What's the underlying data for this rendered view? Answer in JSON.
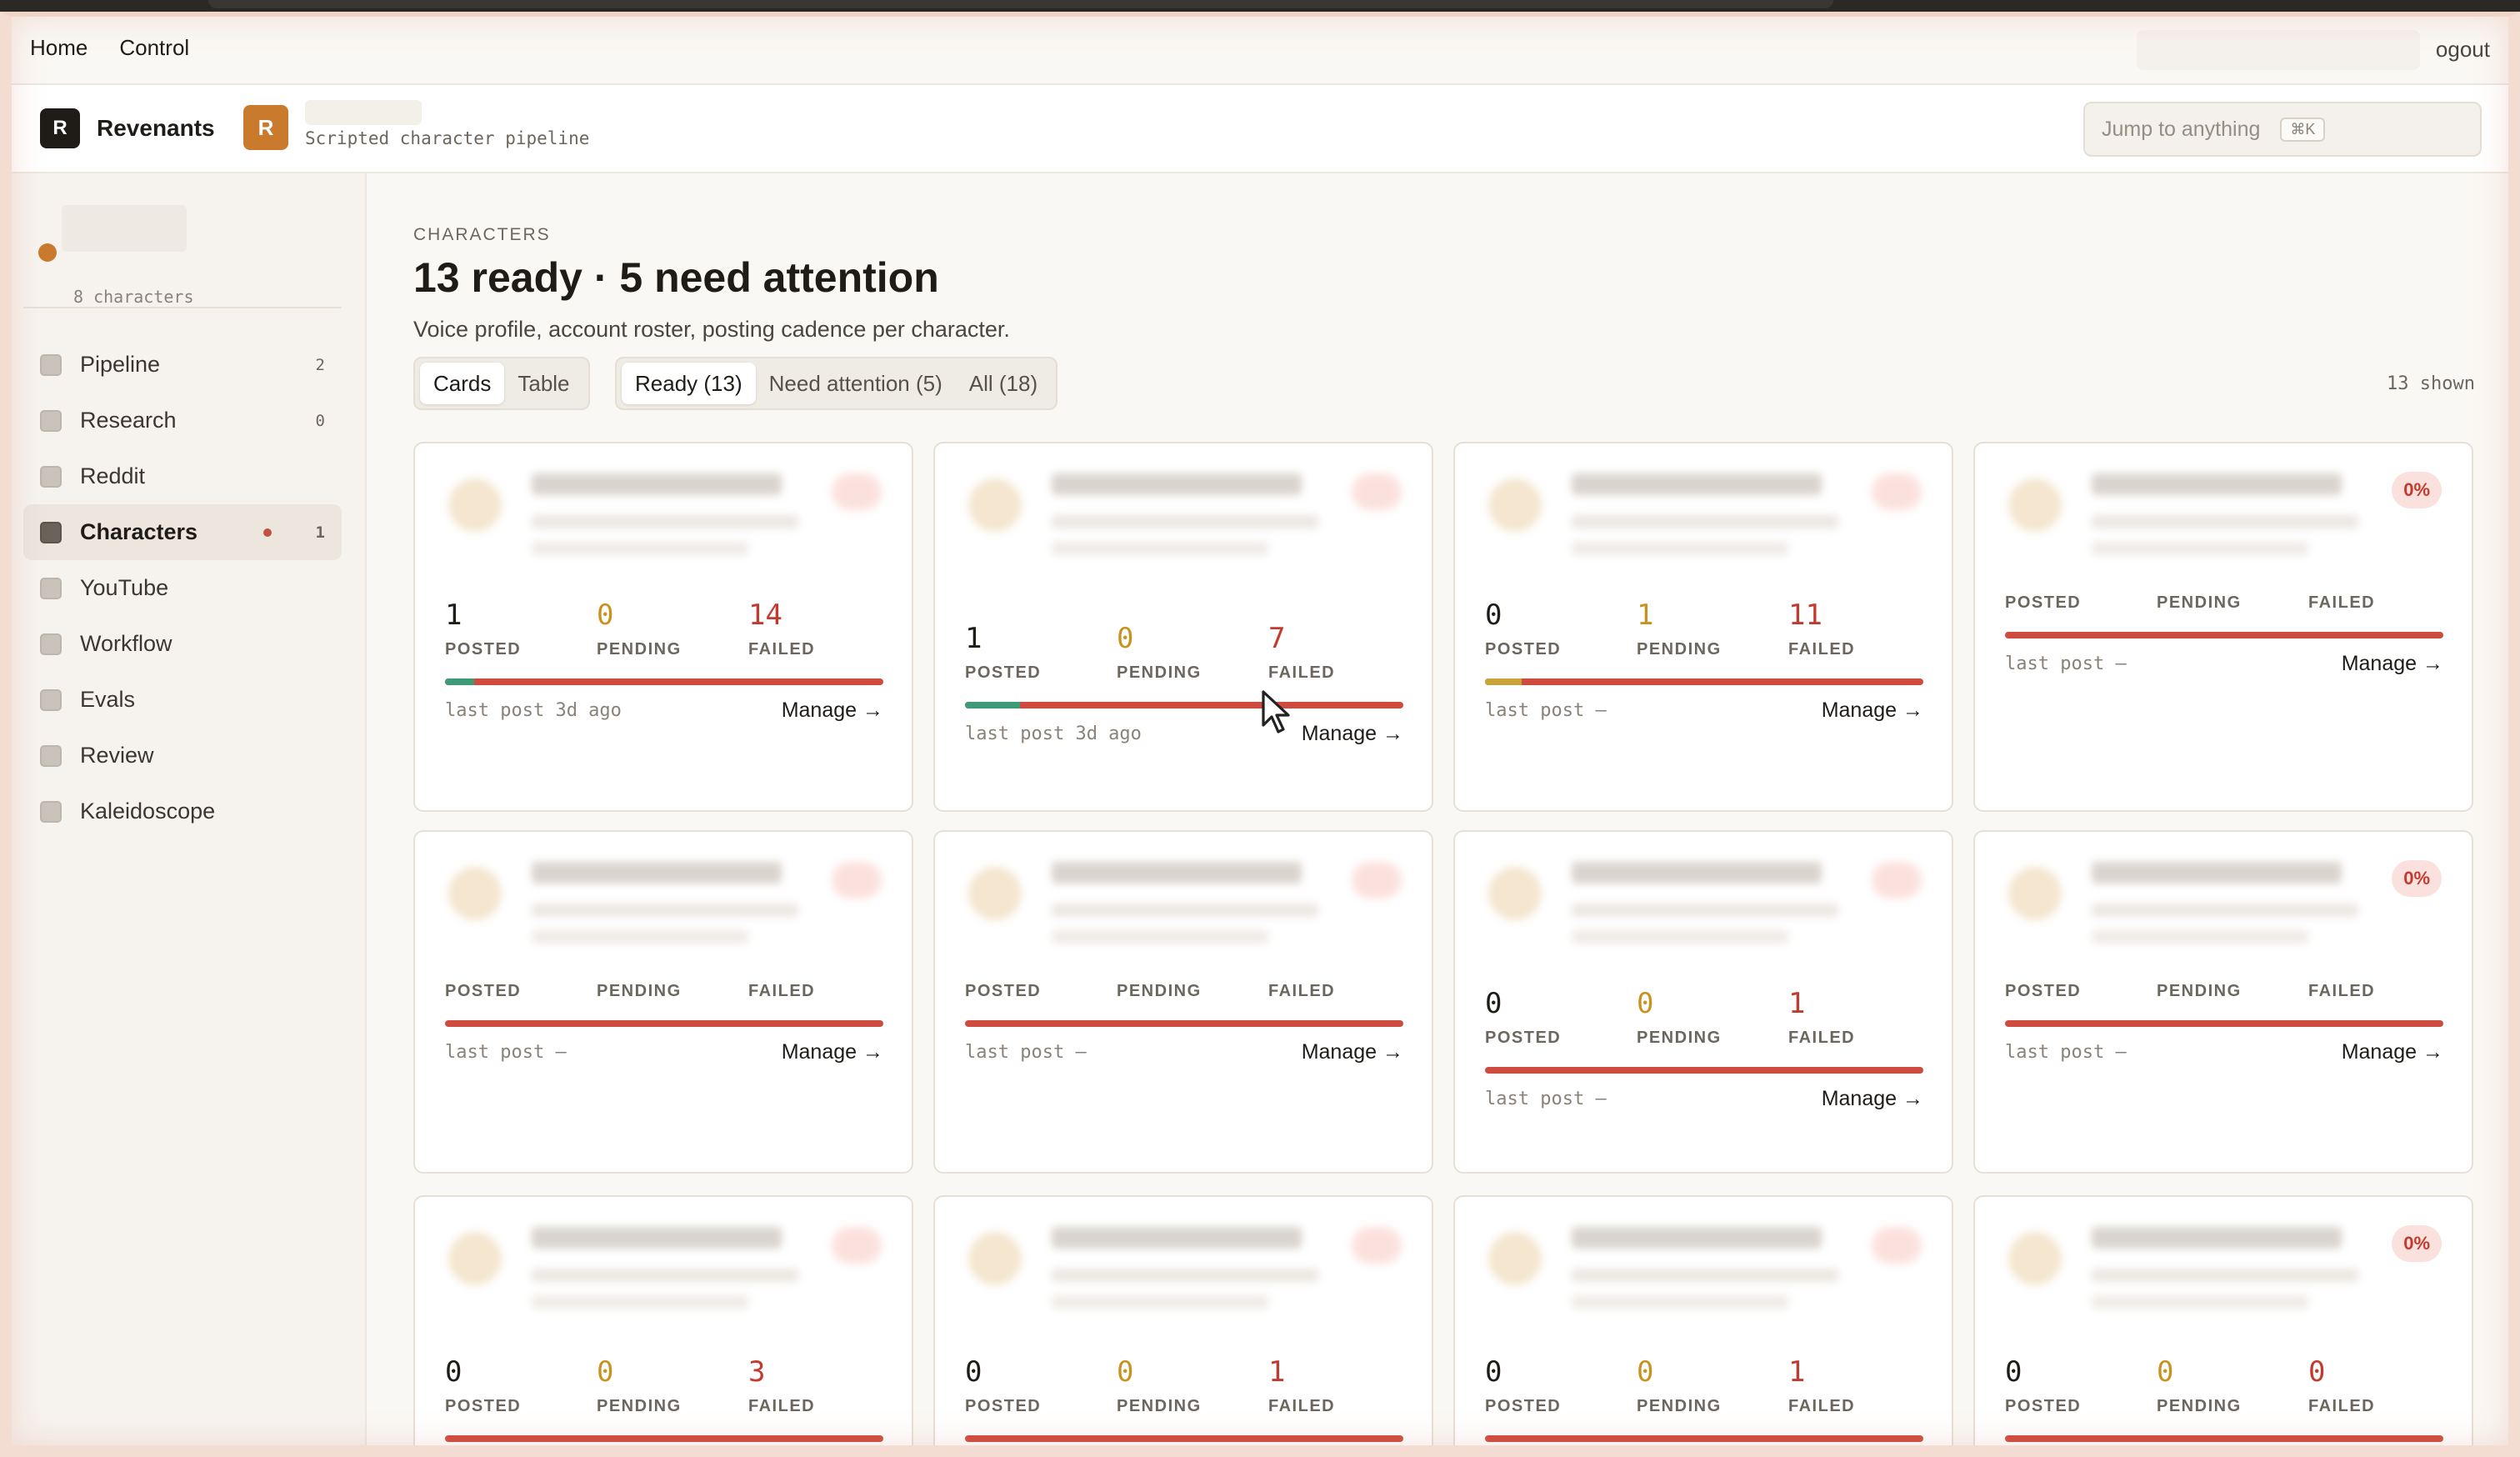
{
  "nav": {
    "home": "Home",
    "control": "Control",
    "logout": "ogout"
  },
  "brand": {
    "letter": "R",
    "name": "Revenants"
  },
  "project": {
    "letter": "R",
    "subtitle": "Scripted character pipeline"
  },
  "search": {
    "placeholder": "Jump to anything",
    "shortcut": "⌘K"
  },
  "workspace": {
    "count_label": "8 characters",
    "status_color": "#c97a2c"
  },
  "sidebar": {
    "items": [
      {
        "label": "Pipeline",
        "badge": "2"
      },
      {
        "label": "Research",
        "badge": "0"
      },
      {
        "label": "Reddit",
        "badge": ""
      },
      {
        "label": "Characters",
        "badge": "1",
        "active": true
      },
      {
        "label": "YouTube",
        "badge": ""
      },
      {
        "label": "Workflow",
        "badge": ""
      },
      {
        "label": "Evals",
        "badge": ""
      },
      {
        "label": "Review",
        "badge": ""
      },
      {
        "label": "Kaleidoscope",
        "badge": ""
      }
    ]
  },
  "page": {
    "eyebrow": "CHARACTERS",
    "title": "13 ready · 5 need attention",
    "description": "Voice profile, account roster, posting cadence per character.",
    "view_toggle": [
      "Cards",
      "Table"
    ],
    "filters": [
      "Ready (13)",
      "Need attention (5)",
      "All (18)"
    ],
    "shown": "13 shown"
  },
  "labels": {
    "posted": "POSTED",
    "pending": "PENDING",
    "failed": "FAILED",
    "manage": "Manage →"
  },
  "cards": [
    {
      "posted": "1",
      "pending": "0",
      "failed": "14",
      "last_post": "last post 3d ago",
      "posted_frac": 0.067,
      "pending_frac": 0,
      "pct": ""
    },
    {
      "posted": "1",
      "pending": "0",
      "failed": "7",
      "last_post": "last post 3d ago",
      "posted_frac": 0.125,
      "pending_frac": 0,
      "pct": ""
    },
    {
      "posted": "0",
      "pending": "1",
      "failed": "11",
      "last_post": "last post —",
      "posted_frac": 0,
      "pending_frac": 0.083,
      "pct": ""
    },
    {
      "posted": "",
      "pending": "",
      "failed": "",
      "last_post": "last post —",
      "posted_frac": 0,
      "pending_frac": 0,
      "pct": "0%"
    },
    {
      "posted": "",
      "pending": "",
      "failed": "",
      "last_post": "last post —",
      "posted_frac": 0,
      "pending_frac": 0,
      "pct": ""
    },
    {
      "posted": "",
      "pending": "",
      "failed": "",
      "last_post": "last post —",
      "posted_frac": 0,
      "pending_frac": 0,
      "pct": ""
    },
    {
      "posted": "0",
      "pending": "0",
      "failed": "1",
      "last_post": "last post —",
      "posted_frac": 0,
      "pending_frac": 0,
      "pct": ""
    },
    {
      "posted": "",
      "pending": "",
      "failed": "",
      "last_post": "last post —",
      "posted_frac": 0,
      "pending_frac": 0,
      "pct": "0%"
    },
    {
      "posted": "0",
      "pending": "0",
      "failed": "3",
      "last_post": "",
      "posted_frac": 0,
      "pending_frac": 0,
      "pct": ""
    },
    {
      "posted": "0",
      "pending": "0",
      "failed": "1",
      "last_post": "",
      "posted_frac": 0,
      "pending_frac": 0,
      "pct": ""
    },
    {
      "posted": "0",
      "pending": "0",
      "failed": "1",
      "last_post": "",
      "posted_frac": 0,
      "pending_frac": 0,
      "pct": ""
    },
    {
      "posted": "0",
      "pending": "0",
      "failed": "0",
      "last_post": "",
      "posted_frac": 0,
      "pending_frac": 0,
      "pct": "0%"
    }
  ],
  "colors": {
    "posted": "#3e9b78",
    "pending": "#c99220",
    "failed": "#c23b2e",
    "accent": "#c97a2c"
  }
}
